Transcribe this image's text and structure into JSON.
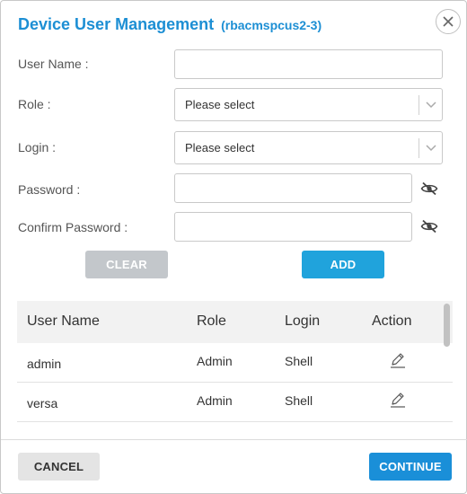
{
  "dialog": {
    "title": "Device User Management",
    "subtitle": "(rbacmspcus2-3)"
  },
  "form": {
    "username_label": "User Name :",
    "username_value": "",
    "role_label": "Role :",
    "role_value": "Please select",
    "login_label": "Login :",
    "login_value": "Please select",
    "password_label": "Password :",
    "password_value": "",
    "confirm_label": "Confirm Password :",
    "confirm_value": ""
  },
  "buttons": {
    "clear": "CLEAR",
    "add": "ADD",
    "cancel": "CANCEL",
    "continue": "CONTINUE"
  },
  "table": {
    "headers": [
      "User Name",
      "Role",
      "Login",
      "Action"
    ],
    "rows": [
      [
        "admin",
        "Admin",
        "Shell"
      ],
      [
        "versa",
        "Admin",
        "Shell"
      ]
    ]
  },
  "icons": {
    "close": "close-icon",
    "dropdown": "chevron-down-icon",
    "visibility": "eye-slash-icon",
    "edit": "pencil-icon"
  },
  "colors": {
    "accent": "#1d8fd4",
    "add_button": "#20a3dc",
    "continue_button": "#1a8fd8",
    "clear_button": "#c3c7cb"
  }
}
